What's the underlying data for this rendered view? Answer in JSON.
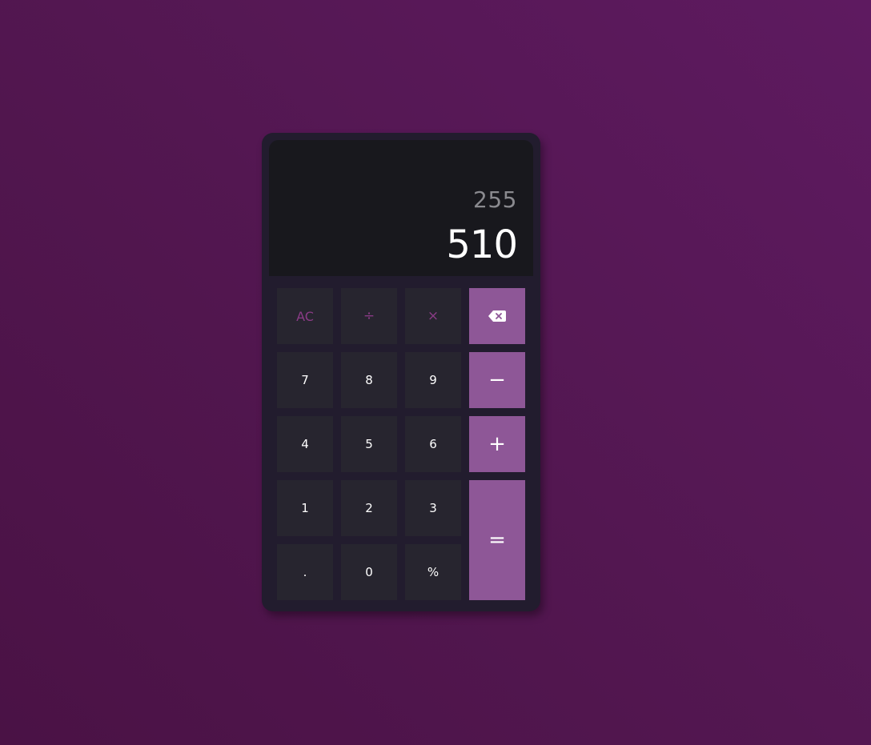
{
  "display": {
    "previous": "255",
    "current": "510"
  },
  "keys": {
    "clear": "AC",
    "divide": "÷",
    "multiply": "×",
    "backspace_icon": "backspace-icon",
    "seven": "7",
    "eight": "8",
    "nine": "9",
    "minus": "−",
    "four": "4",
    "five": "5",
    "six": "6",
    "plus": "+",
    "one": "1",
    "two": "2",
    "three": "3",
    "equals": "=",
    "decimal": ".",
    "zero": "0",
    "percent": "%"
  },
  "colors": {
    "background": "#531751",
    "body": "#221c2e",
    "screen": "#18181d",
    "key": "#27252f",
    "accent": "#8e5797",
    "function_text": "#8a3b86"
  }
}
